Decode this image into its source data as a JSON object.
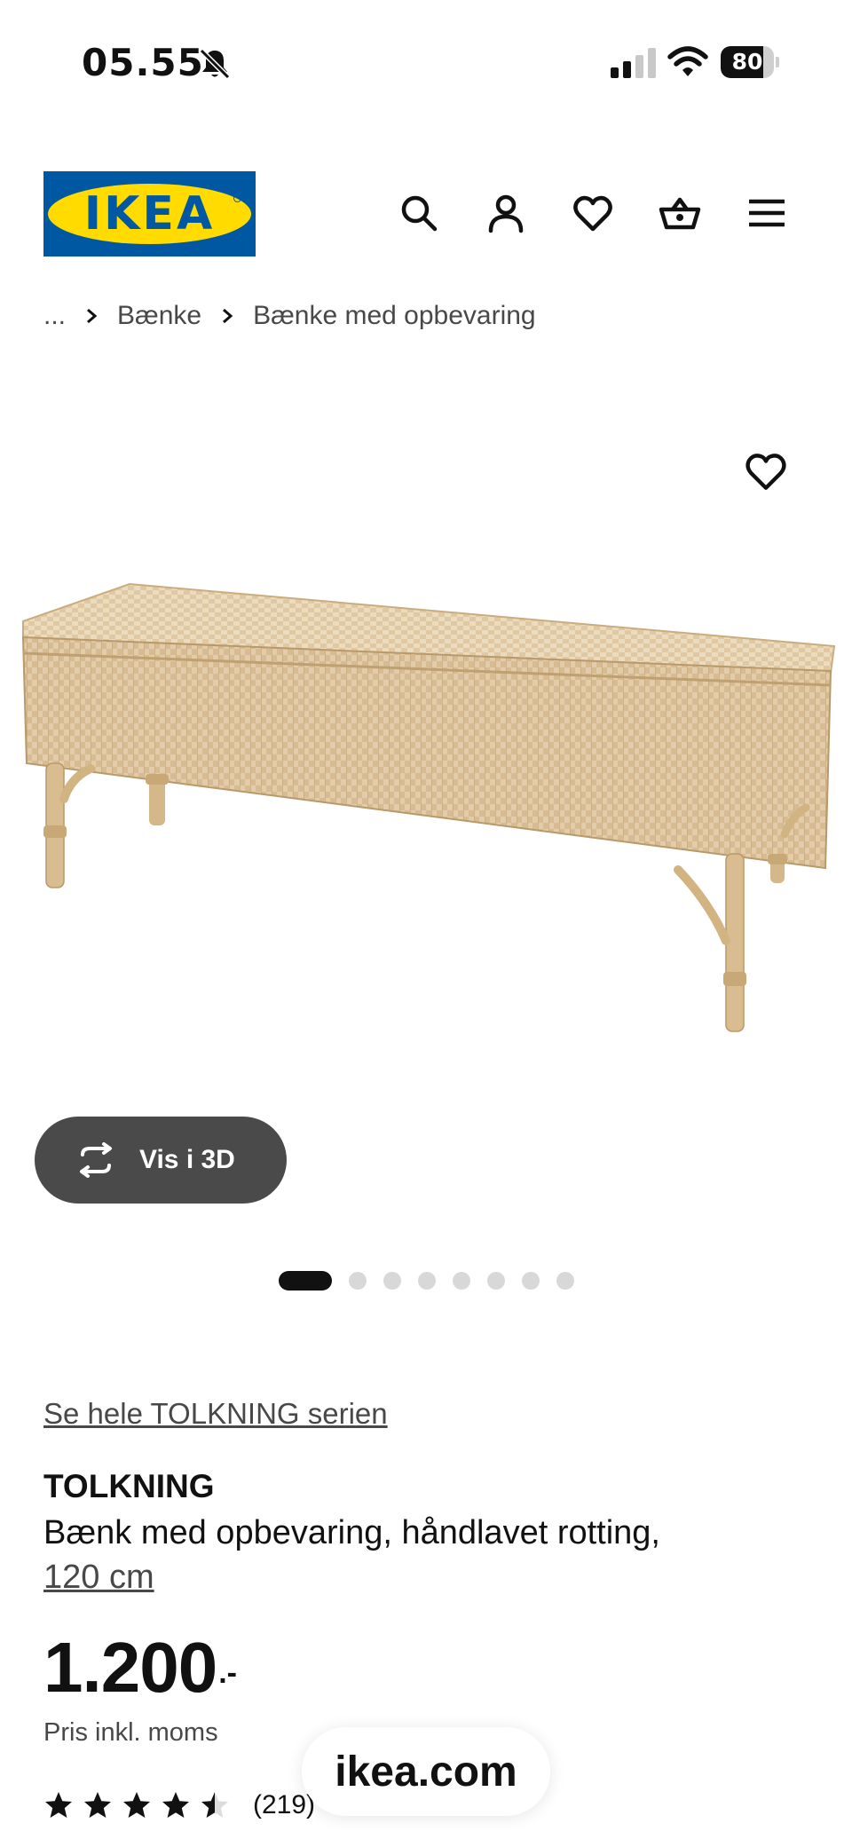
{
  "status_bar": {
    "time": "05.55",
    "battery_percent": "80",
    "battery_level": 0.8
  },
  "header": {
    "logo_text": "IKEA",
    "icons": [
      "search-icon",
      "profile-icon",
      "heart-icon",
      "basket-icon",
      "menu-icon"
    ]
  },
  "breadcrumb": {
    "items": [
      "...",
      "Bænke",
      "Bænke med opbevaring"
    ]
  },
  "gallery": {
    "view_3d_label": "Vis i 3D",
    "image_count": 8,
    "active_index": 0
  },
  "product": {
    "series_link": "Se hele TOLKNING serien",
    "name": "TOLKNING",
    "description": "Bænk med opbevaring, håndlavet rotting,",
    "size": "120 cm",
    "price_integer": "1.200",
    "price_decimal": ".-",
    "price_note": "Pris inkl. moms",
    "rating": 4.5,
    "rating_max": 5,
    "review_count": "(219)"
  },
  "browser": {
    "url": "ikea.com"
  },
  "colors": {
    "ikea_blue": "#0058a3",
    "ikea_yellow": "#ffdb00",
    "pill_dark": "#4a4a4a",
    "text_secondary": "#484848"
  }
}
